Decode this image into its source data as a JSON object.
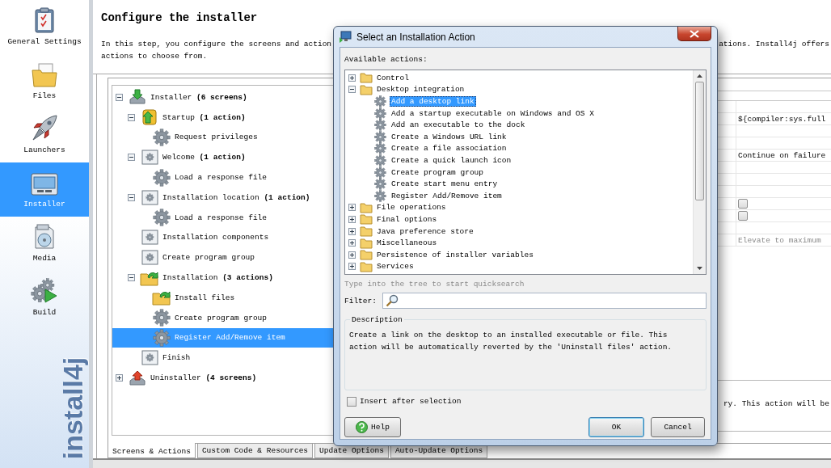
{
  "sidebar": {
    "items": [
      {
        "label": "General Settings",
        "kind": "settings",
        "selected": false
      },
      {
        "label": "Files",
        "kind": "files",
        "selected": false
      },
      {
        "label": "Launchers",
        "kind": "launchers",
        "selected": false
      },
      {
        "label": "Installer",
        "kind": "installer",
        "selected": true
      },
      {
        "label": "Media",
        "kind": "media",
        "selected": false
      },
      {
        "label": "Build",
        "kind": "build",
        "selected": false
      }
    ],
    "brand": "install4j"
  },
  "header": {
    "title": "Configure the installer",
    "intro_start": "In this step, you configure the screens and action",
    "intro_end": "ations. Install4j offers",
    "intro_line_2": "actions to choose from."
  },
  "screens_tree": [
    {
      "label": "Installer **(6 screens)**",
      "kind": "installer",
      "expanded": true,
      "selected": false,
      "children": [
        {
          "label": "Startup **(1 action)**",
          "kind": "startup",
          "expanded": true,
          "selected": false,
          "children": [
            {
              "label": "Request privileges",
              "kind": "action",
              "selected": false
            }
          ]
        },
        {
          "label": "Welcome **(1 action)**",
          "kind": "screen",
          "expanded": true,
          "selected": false,
          "children": [
            {
              "label": "Load a response file",
              "kind": "action",
              "selected": false
            }
          ]
        },
        {
          "label": "Installation location **(1 action)**",
          "kind": "screen",
          "expanded": true,
          "selected": false,
          "children": [
            {
              "label": "Load a response file",
              "kind": "action",
              "selected": false
            }
          ]
        },
        {
          "label": "Installation components",
          "kind": "screen",
          "selected": false
        },
        {
          "label": "Create program group",
          "kind": "screen",
          "selected": false
        },
        {
          "label": "Installation **(3 actions)**",
          "kind": "installation",
          "expanded": true,
          "selected": false,
          "children": [
            {
              "label": "Install files",
              "kind": "install-files",
              "selected": false
            },
            {
              "label": "Create program group",
              "kind": "action",
              "selected": false
            },
            {
              "label": "Register Add/Remove item",
              "kind": "action",
              "selected": true
            }
          ]
        },
        {
          "label": "Finish",
          "kind": "screen",
          "selected": false
        }
      ]
    },
    {
      "label": "Uninstaller **(4 screens)**",
      "kind": "uninstaller",
      "expanded": false,
      "selected": false
    }
  ],
  "properties": {
    "rows": [
      {
        "kind": "blank"
      },
      {
        "kind": "text",
        "value": "${compiler:sys.full"
      },
      {
        "kind": "blank"
      },
      {
        "kind": "blank"
      },
      {
        "kind": "text",
        "value": "Continue on failure"
      },
      {
        "kind": "blank"
      },
      {
        "kind": "blank"
      },
      {
        "kind": "blank"
      },
      {
        "kind": "checkbox",
        "checked": false
      },
      {
        "kind": "checkbox",
        "checked": false
      },
      {
        "kind": "blank"
      },
      {
        "kind": "hint",
        "value": "Elevate to maximum"
      }
    ],
    "description": "ry. This action will be"
  },
  "tabs": [
    {
      "label": "Screens & Actions",
      "selected": true
    },
    {
      "label": "Custom Code & Resources",
      "selected": false
    },
    {
      "label": "Update Options",
      "selected": false
    },
    {
      "label": "Auto-Update Options",
      "selected": false
    }
  ],
  "dialog": {
    "title": "Select an Installation Action",
    "tree_label": "Available actions:",
    "actions": [
      {
        "label": "Control",
        "kind": "category",
        "expanded": false,
        "selected": false
      },
      {
        "label": "Desktop integration",
        "kind": "category",
        "expanded": true,
        "selected": false,
        "children": [
          {
            "label": "Add a desktop link",
            "kind": "action",
            "selected": true
          },
          {
            "label": "Add a startup executable on Windows and OS X",
            "kind": "action",
            "selected": false
          },
          {
            "label": "Add an executable to the dock",
            "kind": "action",
            "selected": false
          },
          {
            "label": "Create a Windows URL link",
            "kind": "action",
            "selected": false
          },
          {
            "label": "Create a file association",
            "kind": "action",
            "selected": false
          },
          {
            "label": "Create a quick launch icon",
            "kind": "action",
            "selected": false
          },
          {
            "label": "Create program group",
            "kind": "action",
            "selected": false
          },
          {
            "label": "Create start menu entry",
            "kind": "action",
            "selected": false
          },
          {
            "label": "Register Add/Remove item",
            "kind": "action",
            "selected": false
          }
        ]
      },
      {
        "label": "File operations",
        "kind": "category",
        "expanded": false,
        "selected": false
      },
      {
        "label": "Final options",
        "kind": "category",
        "expanded": false,
        "selected": false
      },
      {
        "label": "Java preference store",
        "kind": "category",
        "expanded": false,
        "selected": false
      },
      {
        "label": "Miscellaneous",
        "kind": "category",
        "expanded": false,
        "selected": false
      },
      {
        "label": "Persistence of installer variables",
        "kind": "category",
        "expanded": false,
        "selected": false
      },
      {
        "label": "Services",
        "kind": "category",
        "expanded": false,
        "selected": false
      }
    ],
    "quicksearch_hint": "Type into the tree to start quicksearch",
    "filter_label": "Filter:",
    "description_title": "Description",
    "description": "Create a link on the desktop to an installed executable or file. This action will be automatically reverted by the 'Uninstall files' action.",
    "insert_after_selection": {
      "label": "Insert after selection",
      "checked": false
    },
    "buttons": [
      {
        "label": "Help",
        "kind": "help"
      },
      {
        "label": "OK",
        "kind": "default"
      },
      {
        "label": "Cancel",
        "kind": "normal"
      }
    ]
  }
}
